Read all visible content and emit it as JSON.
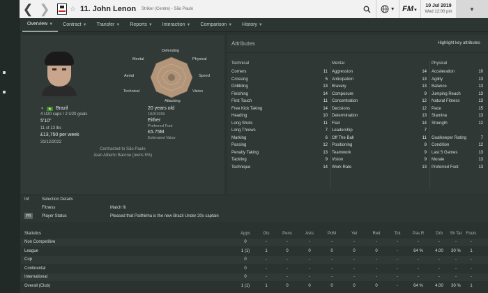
{
  "topbar": {
    "back_icon": "chevron-left-icon",
    "forward_icon": "chevron-right-icon",
    "player_title": "11. John Lenon",
    "player_sub": "Striker (Centre) - São Paulo",
    "date_line1": "10 Jul 2019",
    "date_line2": "Wed 12:00 pm"
  },
  "subnav": {
    "tabs": [
      {
        "label": "Overview"
      },
      {
        "label": "Contract"
      },
      {
        "label": "Transfer"
      },
      {
        "label": "Reports"
      },
      {
        "label": "Interaction"
      },
      {
        "label": "Comparison"
      },
      {
        "label": "History"
      }
    ]
  },
  "profile": {
    "nationality": "Brazil",
    "caps": "4 U20 caps / 2 U20 goals",
    "height": "5'10\"",
    "weight": "11 st 13 lbs",
    "wage": "£13,750 per week",
    "expiry": "31/12/2022",
    "age": "20 years old",
    "dob": "18/3/1999",
    "foot": "Either",
    "foot_label": "Preferred Foot",
    "value": "£5.75M",
    "value_label": "Estimated Value",
    "contracted_to": "Contracted to São Paulo",
    "agent": "Jean Alberto Barone (owns 5%)",
    "radar_labels": {
      "defending": "Defending",
      "physical": "Physical",
      "speed": "Speed",
      "vision": "Vision",
      "attacking": "Attacking",
      "technical": "Technical",
      "aerial": "Aerial",
      "mental": "Mental"
    }
  },
  "attributes": {
    "title": "Attributes",
    "highlight": "Highlight key attributes",
    "technical": {
      "head": "Technical",
      "rows": [
        {
          "name": "Corners",
          "v": "11"
        },
        {
          "name": "Crossing",
          "v": "5"
        },
        {
          "name": "Dribbling",
          "v": "13"
        },
        {
          "name": "Finishing",
          "v": "14"
        },
        {
          "name": "First Touch",
          "v": "11"
        },
        {
          "name": "Free Kick Taking",
          "v": "14"
        },
        {
          "name": "Heading",
          "v": "10"
        },
        {
          "name": "Long Shots",
          "v": "11"
        },
        {
          "name": "Long Throws",
          "v": "7"
        },
        {
          "name": "Marking",
          "v": "6"
        },
        {
          "name": "Passing",
          "v": "12"
        },
        {
          "name": "Penalty Taking",
          "v": "13"
        },
        {
          "name": "Tackling",
          "v": "9"
        },
        {
          "name": "Technique",
          "v": "14"
        }
      ]
    },
    "mental": {
      "head": "Mental",
      "rows": [
        {
          "name": "Aggression",
          "v": "14"
        },
        {
          "name": "Anticipation",
          "v": "13"
        },
        {
          "name": "Bravery",
          "v": "13"
        },
        {
          "name": "Composure",
          "v": "9"
        },
        {
          "name": "Concentration",
          "v": "12"
        },
        {
          "name": "Decisions",
          "v": "12"
        },
        {
          "name": "Determination",
          "v": "13"
        },
        {
          "name": "Flair",
          "v": "14"
        },
        {
          "name": "Leadership",
          "v": "7"
        },
        {
          "name": "Off The Ball",
          "v": "11"
        },
        {
          "name": "Positioning",
          "v": "8"
        },
        {
          "name": "Teamwork",
          "v": "9"
        },
        {
          "name": "Vision",
          "v": "9"
        },
        {
          "name": "Work Rate",
          "v": "13"
        }
      ]
    },
    "physical": {
      "head": "Physical",
      "rows": [
        {
          "name": "Acceleration",
          "v": "10"
        },
        {
          "name": "Agility",
          "v": "13"
        },
        {
          "name": "Balance",
          "v": "13"
        },
        {
          "name": "Jumping Reach",
          "v": "13"
        },
        {
          "name": "Natural Fitness",
          "v": "13"
        },
        {
          "name": "Pace",
          "v": "15"
        },
        {
          "name": "Stamina",
          "v": "13"
        },
        {
          "name": "Strength",
          "v": "12"
        },
        {
          "name": "",
          "v": ""
        },
        {
          "name": "Goalkeeper Rating",
          "v": "7"
        },
        {
          "name": "Condition",
          "v": "12"
        },
        {
          "name": "Last 5 Games",
          "v": "13"
        },
        {
          "name": "Morale",
          "v": "13"
        },
        {
          "name": "Preferred Foot",
          "v": "13"
        }
      ]
    }
  },
  "selection": {
    "inf": "Inf",
    "title": "Selection Details",
    "fitness_label": "Fitness",
    "fitness_value": "Match fit",
    "status_badge": "PR",
    "status_label": "Player Status",
    "status_value": "Pleased that Paithinha is the new Brazil Under 20s captain"
  },
  "stats": {
    "headers": [
      "Statistics",
      "Apps",
      "Gls",
      "Pens",
      "Asts",
      "PoM",
      "Yel",
      "Red",
      "Tck",
      "Pas R",
      "Drb",
      "Sh Tar",
      "Fouls"
    ],
    "rows": [
      {
        "label": "Non Competitive",
        "vals": [
          "0",
          "-",
          "-",
          "-",
          "-",
          "-",
          "-",
          "-",
          "-",
          "-",
          "-",
          "-"
        ]
      },
      {
        "label": "League",
        "vals": [
          "1 (1)",
          "1",
          "0",
          "0",
          "0",
          "0",
          "0",
          "-",
          "64 %",
          "4.00",
          "30 %",
          "1"
        ]
      },
      {
        "label": "Cup",
        "vals": [
          "0",
          "-",
          "-",
          "-",
          "-",
          "-",
          "-",
          "-",
          "-",
          "-",
          "-",
          "-"
        ]
      },
      {
        "label": "Continental",
        "vals": [
          "0",
          "-",
          "-",
          "-",
          "-",
          "-",
          "-",
          "-",
          "-",
          "-",
          "-",
          "-"
        ]
      },
      {
        "label": "International",
        "vals": [
          "0",
          "-",
          "-",
          "-",
          "-",
          "-",
          "-",
          "-",
          "-",
          "-",
          "-",
          "-"
        ]
      },
      {
        "label": "Overall (Club)",
        "vals": [
          "1 (1)",
          "1",
          "0",
          "0",
          "0",
          "0",
          "0",
          "-",
          "64 %",
          "4.00",
          "30 %",
          "1"
        ]
      }
    ]
  }
}
